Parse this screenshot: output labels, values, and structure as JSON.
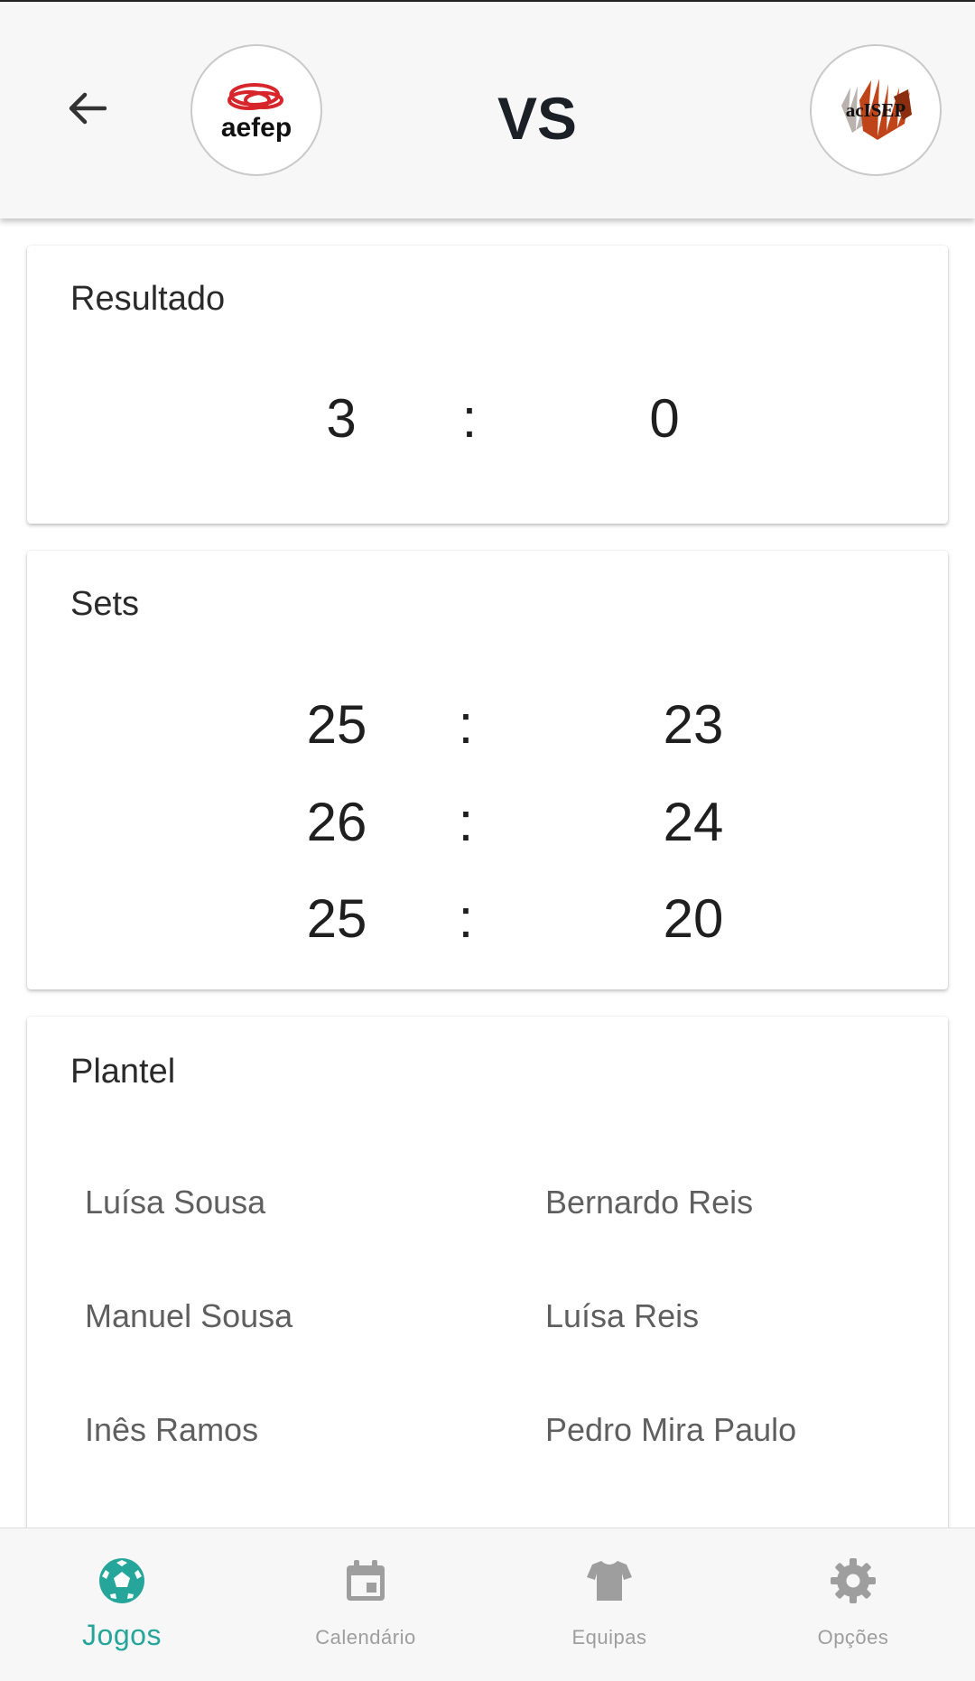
{
  "header": {
    "home_team_logo_text": "aefep",
    "vs_label": "VS",
    "away_team_logo_text": "acISEP"
  },
  "resultado": {
    "title": "Resultado",
    "home": "3",
    "separator": ":",
    "away": "0"
  },
  "sets": {
    "title": "Sets",
    "rows": [
      {
        "home": "25",
        "separator": ":",
        "away": "23"
      },
      {
        "home": "26",
        "separator": ":",
        "away": "24"
      },
      {
        "home": "25",
        "separator": ":",
        "away": "20"
      }
    ]
  },
  "plantel": {
    "title": "Plantel",
    "players": [
      "Luísa Sousa",
      "Bernardo Reis",
      "Manuel Sousa",
      "Luísa Reis",
      "Inês Ramos",
      "Pedro Mira Paulo"
    ]
  },
  "bottom_nav": {
    "items": [
      {
        "label": "Jogos",
        "icon": "soccer-ball-icon",
        "active": true
      },
      {
        "label": "Calendário",
        "icon": "calendar-icon",
        "active": false
      },
      {
        "label": "Equipas",
        "icon": "shirt-icon",
        "active": false
      },
      {
        "label": "Opções",
        "icon": "gear-icon",
        "active": false
      }
    ]
  },
  "colors": {
    "accent": "#26a69a",
    "inactive": "#9e9e9e",
    "away_logo_brand": "#c0441a",
    "home_logo_brand": "#d7262b"
  }
}
